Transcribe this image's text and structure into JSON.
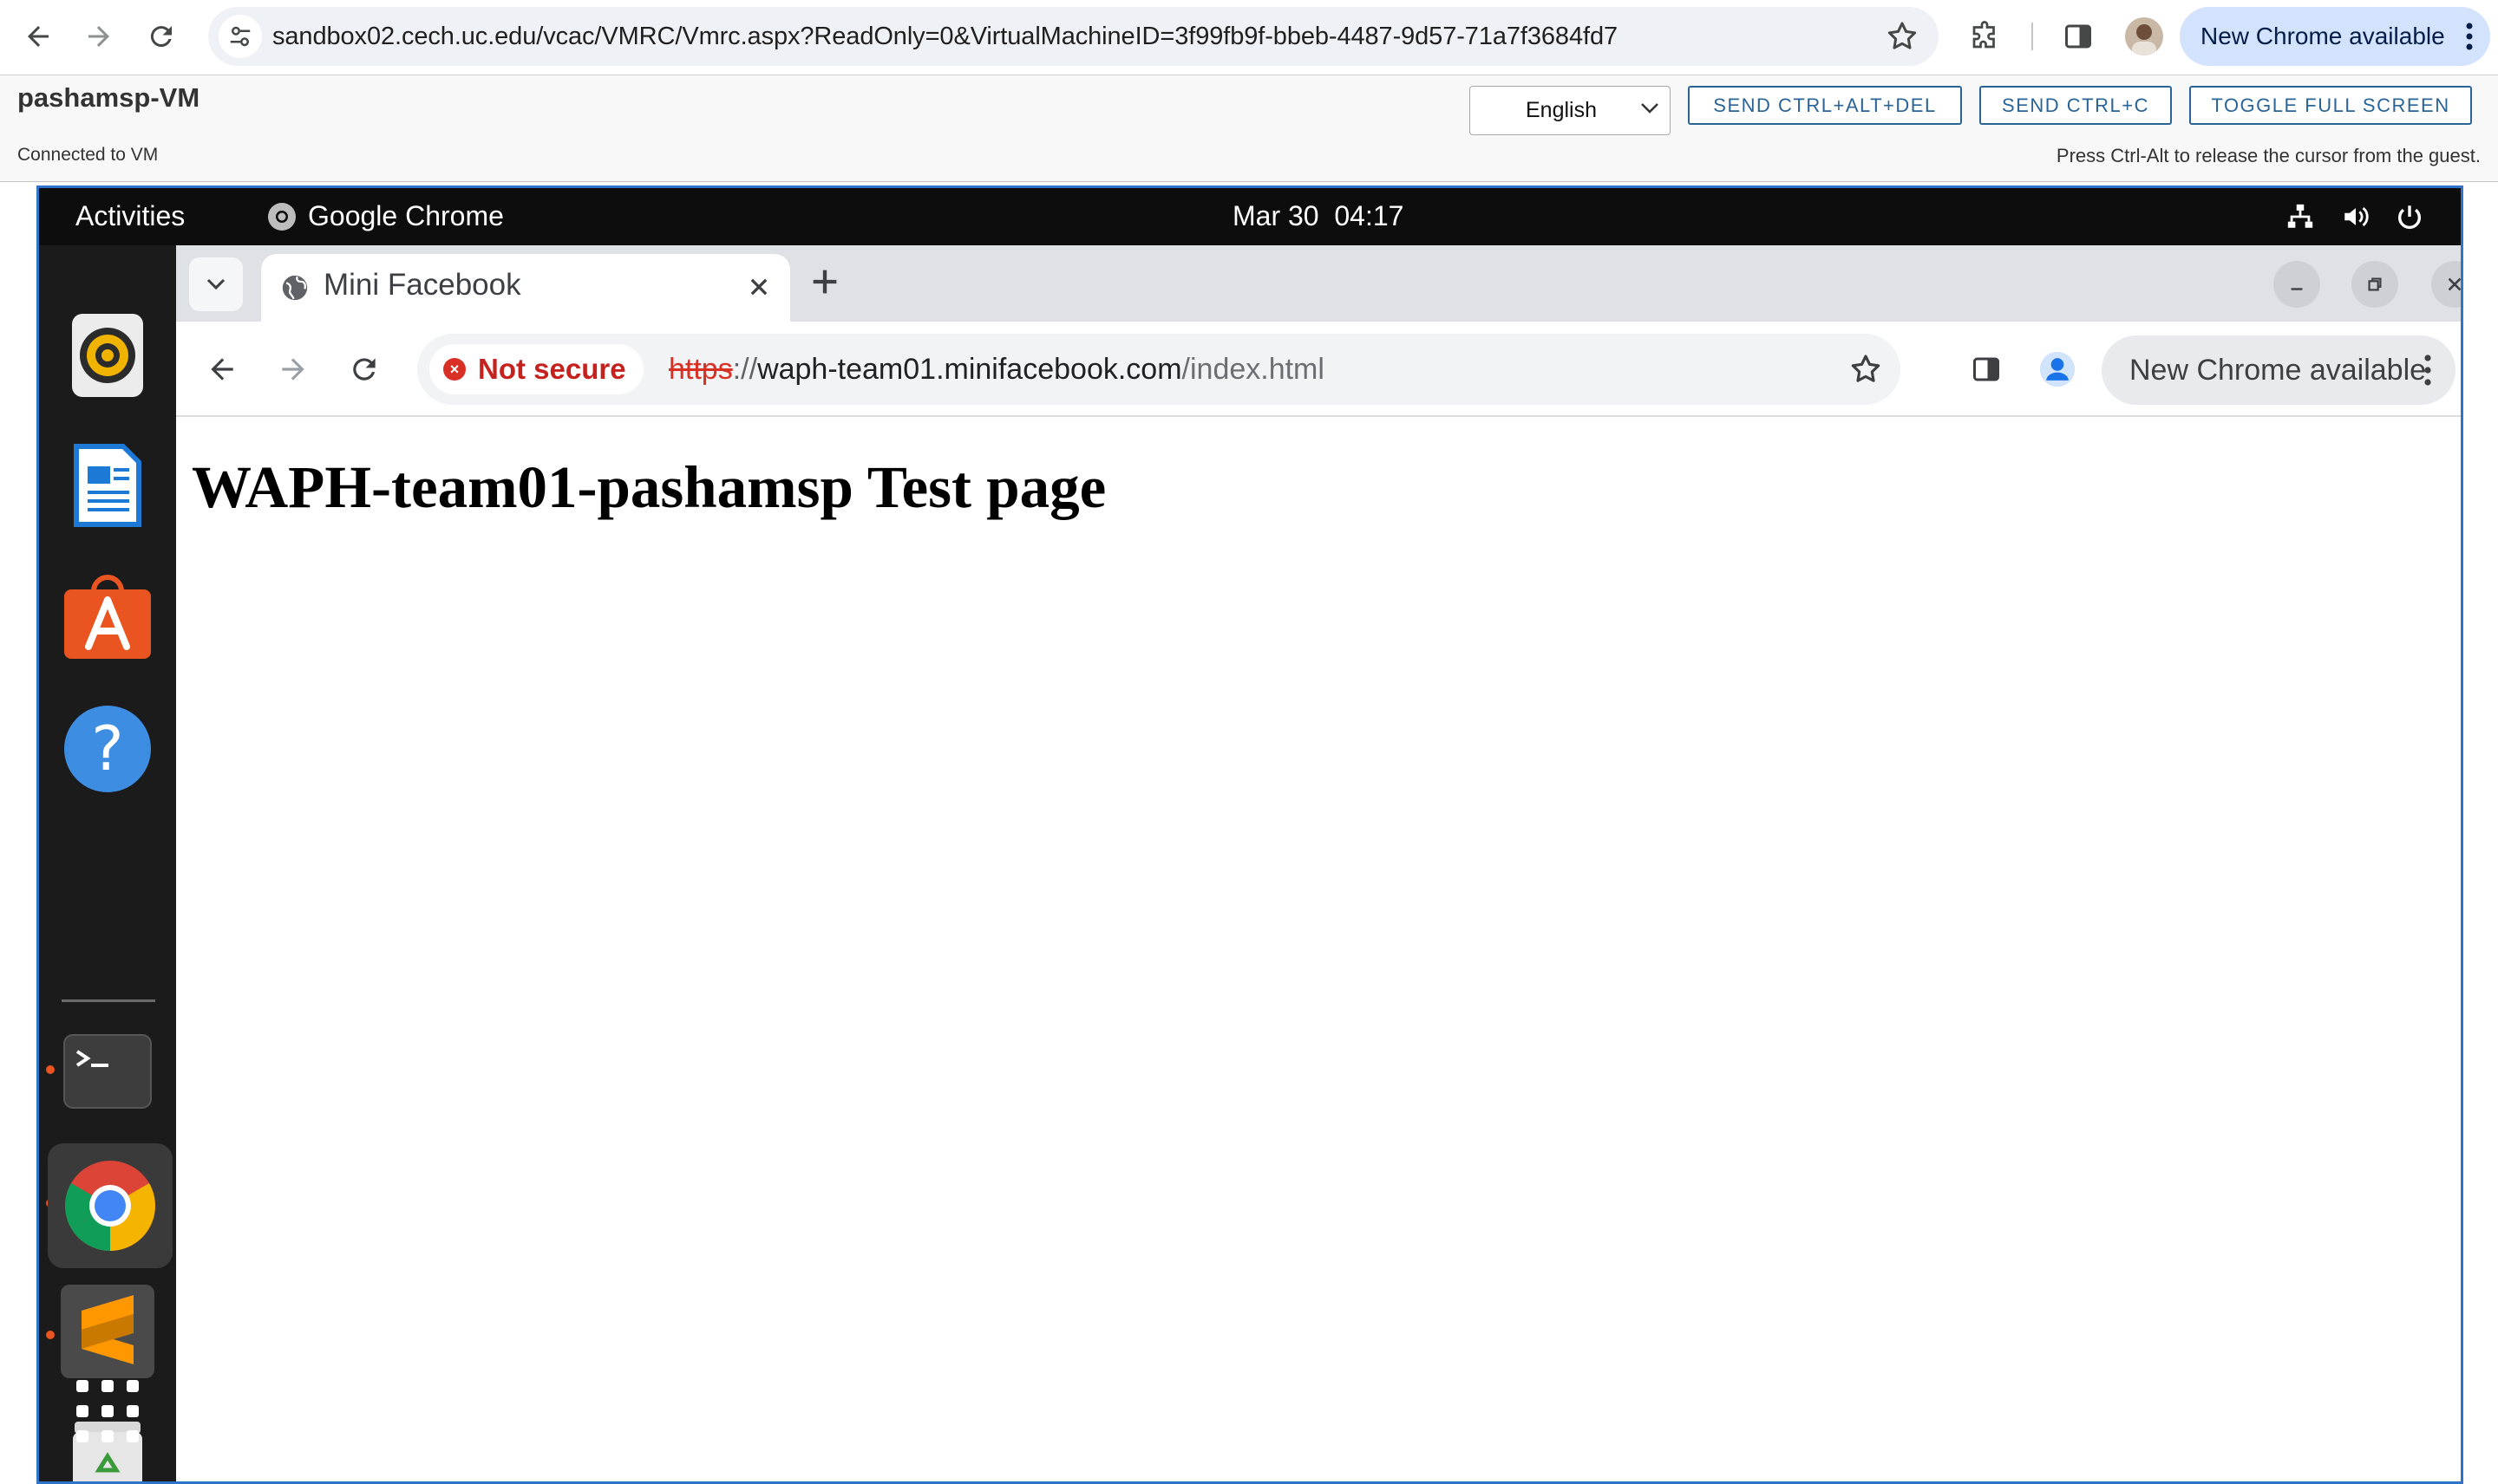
{
  "host_browser": {
    "url": "sandbox02.cech.uc.edu/vcac/VMRC/Vmrc.aspx?ReadOnly=0&VirtualMachineID=3f99fb9f-bbeb-4487-9d57-71a7f3684fd7",
    "update_label": "New Chrome available"
  },
  "vmrc": {
    "vm_name": "pashamsp-VM",
    "status": "Connected to VM",
    "language": "English",
    "buttons": {
      "ctrl_alt_del": "SEND CTRL+ALT+DEL",
      "ctrl_c": "SEND CTRL+C",
      "fullscreen": "TOGGLE FULL SCREEN"
    },
    "hint": "Press Ctrl-Alt to release the cursor from the guest."
  },
  "gnome": {
    "activities": "Activities",
    "app_name": "Google Chrome",
    "date": "Mar 30",
    "time": "04:17",
    "dock": [
      "rhythmbox-icon",
      "libreoffice-writer-icon",
      "ubuntu-software-icon",
      "help-icon",
      "terminal-icon",
      "chrome-icon",
      "sublime-text-icon",
      "trash-icon",
      "show-apps-icon"
    ]
  },
  "guest_browser": {
    "tab_title": "Mini Facebook",
    "security_label": "Not secure",
    "url_scheme": "https",
    "url_sep": "://",
    "url_host": "waph-team01.minifacebook.com",
    "url_path": "/index.html",
    "update_label": "New Chrome available"
  },
  "page": {
    "heading": "WAPH-team01-pashamsp Test page"
  },
  "colors": {
    "host_accent": "#d3e3fd",
    "vmrc_button": "#2a6496",
    "console_border": "#2e74c9",
    "not_secure_red": "#c5221f",
    "ubuntu_orange": "#e95420"
  }
}
